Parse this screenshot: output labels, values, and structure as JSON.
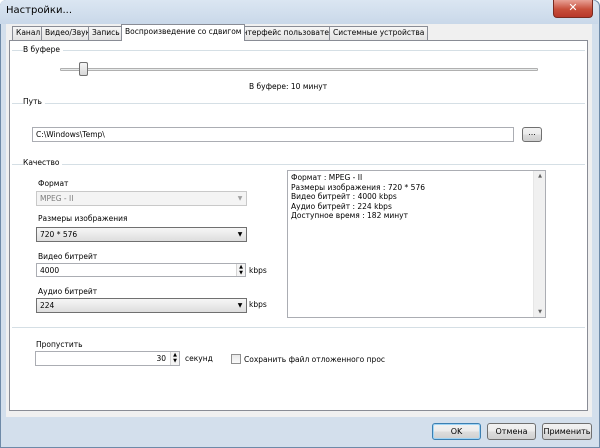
{
  "window": {
    "title": "Настройки...",
    "close_glyph": "✕"
  },
  "tabs": [
    {
      "label": "Канал",
      "active": false
    },
    {
      "label": "Видео/Звук",
      "active": false
    },
    {
      "label": "Запись",
      "active": false
    },
    {
      "label": "Воспроизведение со сдвигом",
      "active": true
    },
    {
      "label": "Интерфейс пользователя",
      "active": false
    },
    {
      "label": "Системные устройства",
      "active": false
    }
  ],
  "buffer": {
    "group_title": "В буфере",
    "slider_value_fraction": 0.05,
    "value_text": "В буфере: 10 минут"
  },
  "path": {
    "group_title": "Путь",
    "value": "C:\\Windows\\Temp\\",
    "browse_label": "..."
  },
  "quality": {
    "group_title": "Качество",
    "format_label": "Формат",
    "format_value": "MPEG - II",
    "image_size_label": "Размеры изображения",
    "image_size_value": "720 * 576",
    "video_bitrate_label": "Видео битрейт",
    "video_bitrate_value": "4000",
    "video_bitrate_unit": "kbps",
    "audio_bitrate_label": "Аудио битрейт",
    "audio_bitrate_value": "224",
    "audio_bitrate_unit": "kbps",
    "info_lines": [
      "Формат : MPEG - II",
      "Размеры изображения : 720 * 576",
      "Видео битрейт : 4000 kbps",
      "Аудио битрейт : 224 kbps",
      "Доступное время : 182 минут"
    ]
  },
  "skip": {
    "label": "Пропустить",
    "value": "30",
    "unit": "секунд",
    "save_checkbox_label": "Сохранить файл отложенного прос",
    "save_checked": false
  },
  "buttons": {
    "ok": "OK",
    "cancel": "Отмена",
    "apply": "Применить"
  }
}
